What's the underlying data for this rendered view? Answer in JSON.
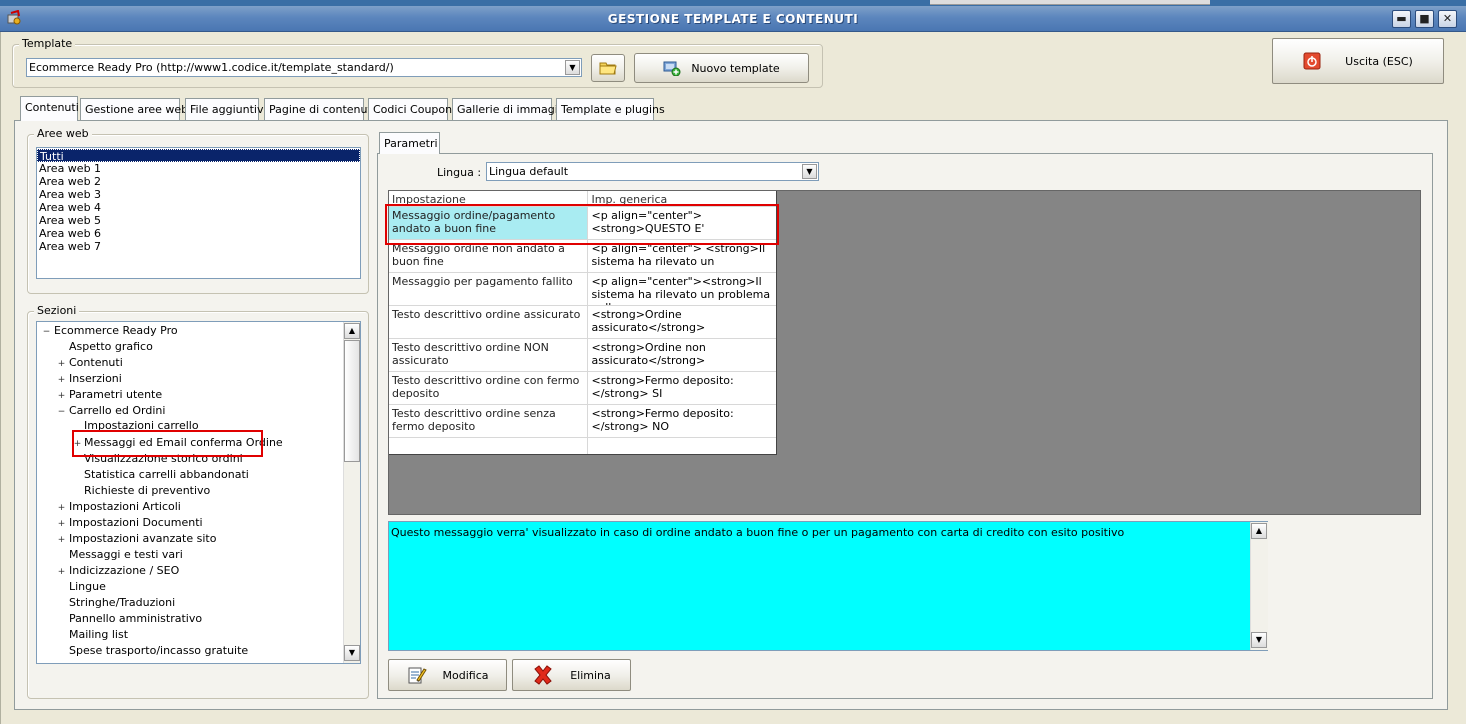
{
  "window": {
    "title": "GESTIONE TEMPLATE E CONTENUTI",
    "buttons": {
      "minimize": "▬",
      "maximize": "■",
      "close": "✕"
    }
  },
  "template": {
    "group_label": "Template",
    "selected": "Ecommerce Ready Pro (http://www1.codice.it/template_standard/)",
    "new_button": "Nuovo template"
  },
  "exit_button": "Uscita (ESC)",
  "tabs": [
    {
      "label": "Contenuti",
      "active": true
    },
    {
      "label": "Gestione aree web"
    },
    {
      "label": "File aggiuntivi"
    },
    {
      "label": "Pagine di contenuti"
    },
    {
      "label": "Codici Coupon"
    },
    {
      "label": "Gallerie di immagini"
    },
    {
      "label": "Template e plugins"
    }
  ],
  "aree_web": {
    "label": "Aree web",
    "items": [
      "Tutti",
      "Area web 1",
      "Area web 2",
      "Area web 3",
      "Area web 4",
      "Area web 5",
      "Area web 6",
      "Area web 7"
    ]
  },
  "sezioni": {
    "label": "Sezioni",
    "items": [
      {
        "text": "Ecommerce Ready Pro",
        "expander": "−"
      },
      {
        "text": "Aspetto grafico",
        "expander": ""
      },
      {
        "text": "Contenuti",
        "expander": "+"
      },
      {
        "text": "Inserzioni",
        "expander": "+"
      },
      {
        "text": "Parametri utente",
        "expander": "+"
      },
      {
        "text": "Carrello ed Ordini",
        "expander": "−"
      },
      {
        "text": "Impostazioni carrello",
        "expander": ""
      },
      {
        "text": "Messaggi ed Email conferma Ordine",
        "expander": "+"
      },
      {
        "text": "Visualizzazione storico ordini",
        "expander": ""
      },
      {
        "text": "Statistica carrelli abbandonati",
        "expander": ""
      },
      {
        "text": "Richieste di preventivo",
        "expander": ""
      },
      {
        "text": "Impostazioni Articoli",
        "expander": "+"
      },
      {
        "text": "Impostazioni Documenti",
        "expander": "+"
      },
      {
        "text": "Impostazioni avanzate sito",
        "expander": "+"
      },
      {
        "text": "Messaggi e testi vari",
        "expander": ""
      },
      {
        "text": "Indicizzazione / SEO",
        "expander": "+"
      },
      {
        "text": "Lingue",
        "expander": ""
      },
      {
        "text": "Stringhe/Traduzioni",
        "expander": ""
      },
      {
        "text": "Pannello amministrativo",
        "expander": ""
      },
      {
        "text": "Mailing list",
        "expander": ""
      },
      {
        "text": "Spese trasporto/incasso gratuite",
        "expander": ""
      }
    ]
  },
  "parametri": {
    "tab_label": "Parametri",
    "lingua_label": "Lingua :",
    "lingua_value": "Lingua default",
    "columns": [
      "Impostazione",
      "Imp. generica"
    ],
    "rows": [
      {
        "name": "Messaggio ordine/pagamento andato a buon fine",
        "value": "<p align=\"center\"><strong>QUESTO E'"
      },
      {
        "name": "Messaggio ordine non andato a buon fine",
        "value": "<p align=\"center\">  <strong>Il sistema ha rilevato un"
      },
      {
        "name": "Messaggio per pagamento fallito",
        "value": "<p align=\"center\"><strong>Il sistema ha rilevato un problema nella"
      },
      {
        "name": "Testo descrittivo ordine assicurato",
        "value": "<strong>Ordine assicurato</strong>"
      },
      {
        "name": "Testo descrittivo ordine NON assicurato",
        "value": "<strong>Ordine non assicurato</strong>"
      },
      {
        "name": "Testo descrittivo ordine con fermo deposito",
        "value": "<strong>Fermo deposito:</strong> SI"
      },
      {
        "name": "Testo descrittivo ordine senza fermo deposito",
        "value": "<strong>Fermo deposito:</strong> NO"
      },
      {
        "name": "",
        "value": ""
      }
    ],
    "description": "Questo messaggio verra' visualizzato in caso di ordine andato a buon fine o per un pagamento con carta di credito con esito positivo",
    "modifica_label": "Modifica",
    "elimina_label": "Elimina"
  },
  "colors": {
    "selection_dark": "#0a246a",
    "selected_row": "#a9ecf2",
    "description_bg": "#00ffff",
    "highlight_red": "#e00000"
  }
}
